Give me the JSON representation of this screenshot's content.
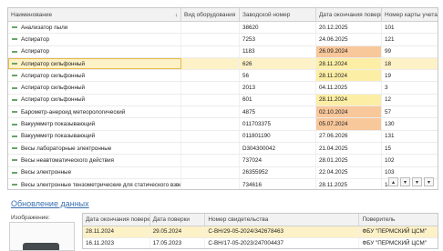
{
  "table": {
    "columns": {
      "name": "Наименование",
      "sort_indicator": "↓",
      "type": "Вид оборудования",
      "serial": "Заводской номер",
      "due": "Дата окончания поверки",
      "card": "Номер карты учета"
    },
    "rows": [
      {
        "name": "Анализатор пыли",
        "type": "",
        "serial": "38620",
        "due": "20.12.2025",
        "card": "101",
        "highlight": ""
      },
      {
        "name": "Аспиратор",
        "type": "",
        "serial": "7253",
        "due": "24.06.2025",
        "card": "121",
        "highlight": ""
      },
      {
        "name": "Аспиратор",
        "type": "",
        "serial": "1183",
        "due": "26.09.2024",
        "card": "99",
        "highlight": "orange"
      },
      {
        "name": "Аспиратор сильфонный",
        "type": "",
        "serial": "626",
        "due": "28.11.2024",
        "card": "18",
        "highlight": "yellow"
      },
      {
        "name": "Аспиратор сильфонный",
        "type": "",
        "serial": "56",
        "due": "28.11.2024",
        "card": "19",
        "highlight": "yellow"
      },
      {
        "name": "Аспиратор сильфонный",
        "type": "",
        "serial": "2013",
        "due": "04.11.2025",
        "card": "3",
        "highlight": ""
      },
      {
        "name": "Аспиратор сильфонный",
        "type": "",
        "serial": "601",
        "due": "28.11.2024",
        "card": "12",
        "highlight": "yellow"
      },
      {
        "name": "Барометр-анероид метеорологический",
        "type": "",
        "serial": "4875",
        "due": "02.10.2024",
        "card": "57",
        "highlight": "orange"
      },
      {
        "name": "Вакуумметр показывающий",
        "type": "",
        "serial": "011703375",
        "due": "05.07.2024",
        "card": "130",
        "highlight": "orange"
      },
      {
        "name": "Вакуумметр показывающий",
        "type": "",
        "serial": "011801190",
        "due": "27.06.2026",
        "card": "131",
        "highlight": ""
      },
      {
        "name": "Весы лабораторные электронные",
        "type": "",
        "serial": "D304300042",
        "due": "21.04.2025",
        "card": "15",
        "highlight": ""
      },
      {
        "name": "Весы неавтоматического действия",
        "type": "",
        "serial": "737024",
        "due": "28.01.2025",
        "card": "102",
        "highlight": ""
      },
      {
        "name": "Весы электронные",
        "type": "",
        "serial": "26355952",
        "due": "22.04.2025",
        "card": "103",
        "highlight": ""
      },
      {
        "name": "Весы электронные тензометрические для статического взве...",
        "type": "",
        "serial": "734616",
        "due": "28.11.2025",
        "card": "14",
        "highlight": ""
      }
    ],
    "selected_index": 3,
    "nav": [
      "▴",
      "▾",
      "▾",
      "▾"
    ]
  },
  "update_link": "Обновление данных",
  "image_label": "Изображение:",
  "history": {
    "columns": {
      "date": "Дата окончания поверки",
      "from": "Дата поверки",
      "cert": "Номер свидетельства",
      "verifier": "Поверитель"
    },
    "rows": [
      {
        "date": "28.11.2024",
        "from": "29.05.2024",
        "cert": "С-ВН/29-05-2024/342678463",
        "verifier": "ФБУ \"ПЕРМСКИЙ ЦСМ\""
      },
      {
        "date": "16.11.2023",
        "from": "17.05.2023",
        "cert": "С-ВН/17-05-2023/247004437",
        "verifier": "ФБУ \"ПЕРМСКИЙ ЦСМ\""
      }
    ]
  },
  "colors": {
    "orange": "#f8c79a",
    "yellow": "#fdeea6",
    "selected": "#fdf1c7",
    "link": "#3a6fb0"
  }
}
